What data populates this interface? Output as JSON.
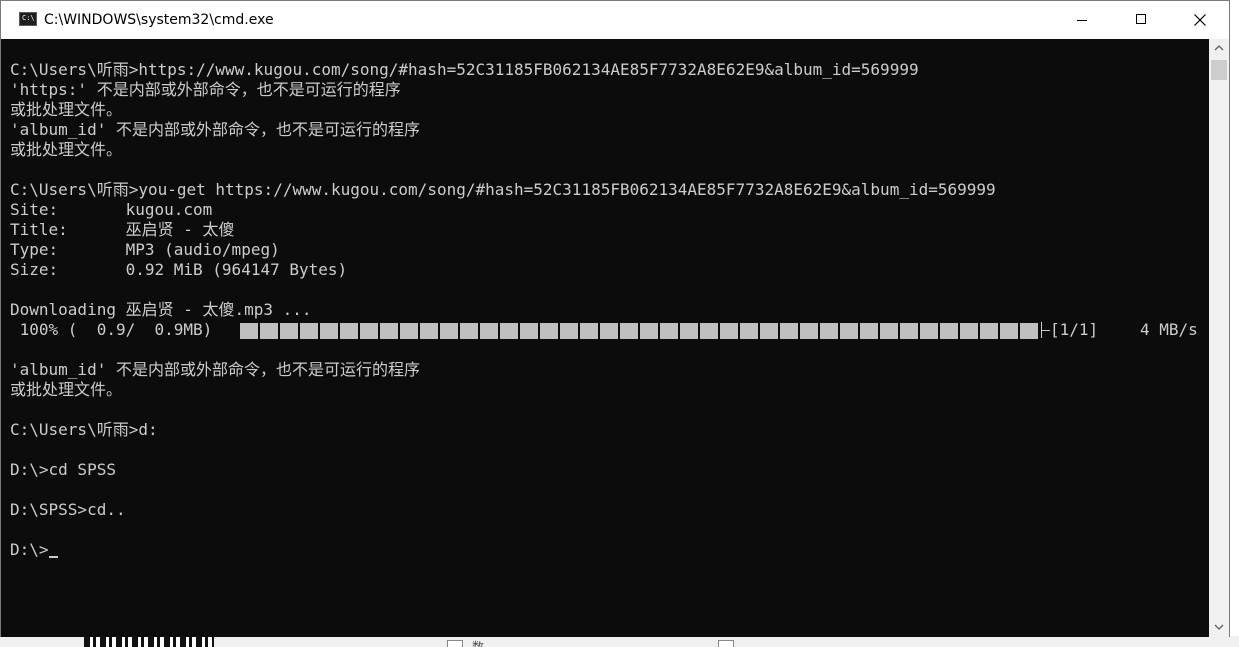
{
  "window": {
    "title": "C:\\WINDOWS\\system32\\cmd.exe",
    "icon": "cmd-icon",
    "icon_glyph": "C:\\"
  },
  "console": {
    "lines_before": [
      "C:\\Users\\听雨>https://www.kugou.com/song/#hash=52C31185FB062134AE85F7732A8E62E9&album_id=569999",
      "'https:' 不是内部或外部命令，也不是可运行的程序",
      "或批处理文件。",
      "'album_id' 不是内部或外部命令，也不是可运行的程序",
      "或批处理文件。",
      "",
      "C:\\Users\\听雨>you-get https://www.kugou.com/song/#hash=52C31185FB062134AE85F7732A8E62E9&album_id=569999",
      "Site:       kugou.com",
      "Title:      巫启贤 - 太傻",
      "Type:       MP3 (audio/mpeg)",
      "Size:       0.92 MiB (964147 Bytes)",
      "",
      "Downloading 巫启贤 - 太傻.mp3 ..."
    ],
    "progress": {
      "percent_text": " 100% (  0.9/  0.9MB)",
      "fraction": 1.0,
      "count": "[1/1]",
      "speed": "4 MB/s"
    },
    "lines_after": [
      "",
      "'album_id' 不是内部或外部命令，也不是可运行的程序",
      "或批处理文件。",
      "",
      "C:\\Users\\听雨>d:",
      "",
      "D:\\>cd SPSS",
      "",
      "D:\\SPSS>cd..",
      "",
      "D:\\>"
    ]
  },
  "background": {
    "checkbox_text_1": "数"
  }
}
